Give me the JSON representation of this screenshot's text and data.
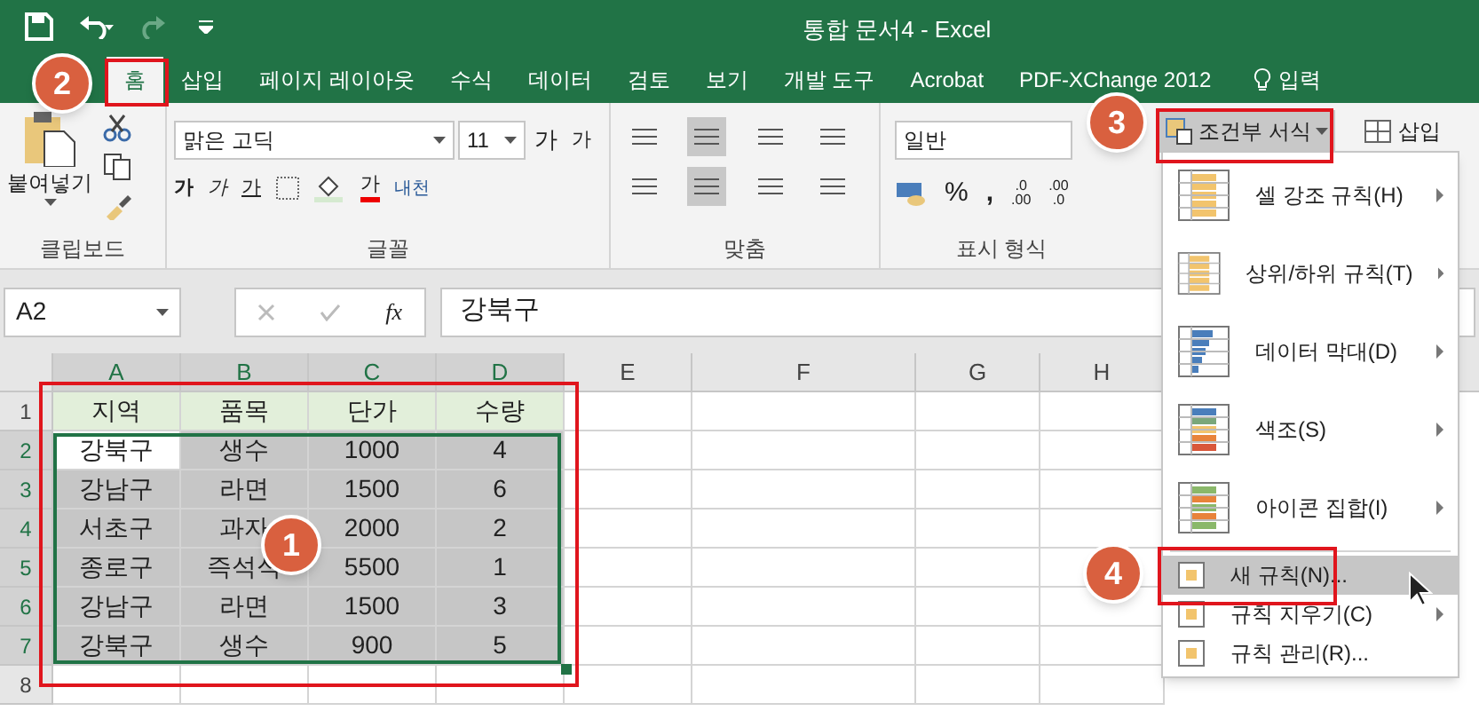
{
  "window": {
    "title": "통합 문서4 - Excel"
  },
  "tabs": [
    {
      "label": "홈",
      "selected": true
    },
    {
      "label": "삽입",
      "selected": false
    },
    {
      "label": "페이지 레이아웃",
      "selected": false
    },
    {
      "label": "수식",
      "selected": false
    },
    {
      "label": "데이터",
      "selected": false
    },
    {
      "label": "검토",
      "selected": false
    },
    {
      "label": "보기",
      "selected": false
    },
    {
      "label": "개발 도구",
      "selected": false
    },
    {
      "label": "Acrobat",
      "selected": false
    },
    {
      "label": "PDF-XChange 2012",
      "selected": false
    }
  ],
  "tell_me": "입력",
  "ribbon": {
    "paste": "붙여넣기",
    "font_name": "맑은 고딕",
    "font_size": "11",
    "grow_font": "가",
    "shrink_font": "가",
    "bold": "가",
    "italic": "가",
    "underline": "가",
    "font_color": "가",
    "phonetic": "내천",
    "number_format": "일반",
    "percent": "%",
    "comma": ",",
    "decimals": [
      {
        "top": ".0",
        "bottom": ".00"
      },
      {
        "top": ".00",
        "bottom": ".0"
      }
    ],
    "conditional_format": "조건부 서식",
    "insert": "삽입",
    "groups": [
      "클립보드",
      "글꼴",
      "맞춤",
      "표시 형식"
    ]
  },
  "formula_bar": {
    "name_box": "A2",
    "fx": "fx",
    "value": "강북구"
  },
  "sheet": {
    "columns": [
      "A",
      "B",
      "C",
      "D",
      "E",
      "F",
      "G",
      "H"
    ],
    "rows": [
      {
        "header": "1",
        "kind": "header",
        "selected": false,
        "cells": [
          {
            "text": "지역",
            "active": false
          },
          {
            "text": "품목",
            "active": false
          },
          {
            "text": "단가",
            "active": false
          },
          {
            "text": "수량",
            "active": false
          }
        ]
      },
      {
        "header": "2",
        "kind": "data",
        "selected": true,
        "cells": [
          {
            "text": "강북구",
            "active": true
          },
          {
            "text": "생수",
            "active": false
          },
          {
            "text": "1000",
            "active": false
          },
          {
            "text": "4",
            "active": false
          }
        ]
      },
      {
        "header": "3",
        "kind": "data",
        "selected": true,
        "cells": [
          {
            "text": "강남구",
            "active": false
          },
          {
            "text": "라면",
            "active": false
          },
          {
            "text": "1500",
            "active": false
          },
          {
            "text": "6",
            "active": false
          }
        ]
      },
      {
        "header": "4",
        "kind": "data",
        "selected": true,
        "cells": [
          {
            "text": "서초구",
            "active": false
          },
          {
            "text": "과자",
            "active": false
          },
          {
            "text": "2000",
            "active": false
          },
          {
            "text": "2",
            "active": false
          }
        ]
      },
      {
        "header": "5",
        "kind": "data",
        "selected": true,
        "cells": [
          {
            "text": "종로구",
            "active": false
          },
          {
            "text": "즉석식",
            "active": false
          },
          {
            "text": "5500",
            "active": false
          },
          {
            "text": "1",
            "active": false
          }
        ]
      },
      {
        "header": "6",
        "kind": "data",
        "selected": true,
        "cells": [
          {
            "text": "강남구",
            "active": false
          },
          {
            "text": "라면",
            "active": false
          },
          {
            "text": "1500",
            "active": false
          },
          {
            "text": "3",
            "active": false
          }
        ]
      },
      {
        "header": "7",
        "kind": "data",
        "selected": true,
        "cells": [
          {
            "text": "강북구",
            "active": false
          },
          {
            "text": "생수",
            "active": false
          },
          {
            "text": "900",
            "active": false
          },
          {
            "text": "5",
            "active": false
          }
        ]
      },
      {
        "header": "8",
        "kind": "data",
        "selected": false,
        "cells": []
      }
    ]
  },
  "menu": {
    "items": [
      {
        "label": "셀 강조 규칙(H)",
        "kind": "large",
        "submenu": true,
        "selected": false
      },
      {
        "label": "상위/하위 규칙(T)",
        "kind": "large",
        "submenu": true,
        "selected": false
      },
      {
        "label": "데이터 막대(D)",
        "kind": "large",
        "submenu": true,
        "selected": false
      },
      {
        "label": "색조(S)",
        "kind": "large",
        "submenu": true,
        "selected": false
      },
      {
        "label": "아이콘 집합(I)",
        "kind": "large",
        "submenu": true,
        "selected": false
      },
      {
        "label": "새 규칙(N)...",
        "kind": "small",
        "submenu": false,
        "selected": true
      },
      {
        "label": "규칙 지우기(C)",
        "kind": "small",
        "submenu": true,
        "selected": false
      },
      {
        "label": "규칙 관리(R)...",
        "kind": "small",
        "submenu": false,
        "selected": false
      }
    ]
  },
  "callouts": [
    "1",
    "2",
    "3",
    "4"
  ]
}
